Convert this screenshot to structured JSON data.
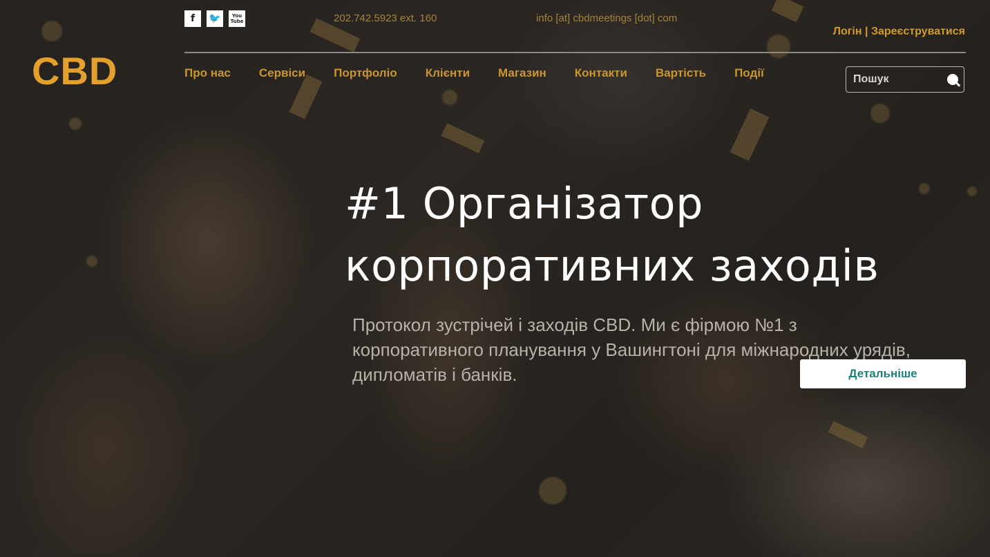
{
  "topbar": {
    "social": [
      {
        "icon": "facebook-icon",
        "glyph": "f"
      },
      {
        "icon": "twitter-icon",
        "glyph": "🐦"
      },
      {
        "icon": "youtube-icon",
        "glyph": "You Tube"
      }
    ],
    "phone": "202.742.5923 ext. 160",
    "email": "info [at] cbdmeetings [dot] com",
    "login_label": "Логін",
    "auth_separator": "|",
    "register_label": "Зареєструватися"
  },
  "brand": {
    "logo_text": "CBD"
  },
  "nav": {
    "items": [
      "Про нас",
      "Сервіси",
      "Портфоліо",
      "Клієнти",
      "Магазин",
      "Контакти",
      "Вартість",
      "Події"
    ]
  },
  "search": {
    "placeholder": "Пошук"
  },
  "hero": {
    "headline_line1": "#1 Організатор",
    "headline_line2": "корпоративних заходів",
    "lead": "Протокол зустрічей і заходів CBD. Ми є фірмою №1 з корпоративного планування у Вашингтоні для міжнародних урядів, дипломатів і банків.",
    "cta_label": "Детальніше"
  },
  "colors": {
    "accent": "#d19b2c",
    "cta_text": "#1e7f7a"
  }
}
